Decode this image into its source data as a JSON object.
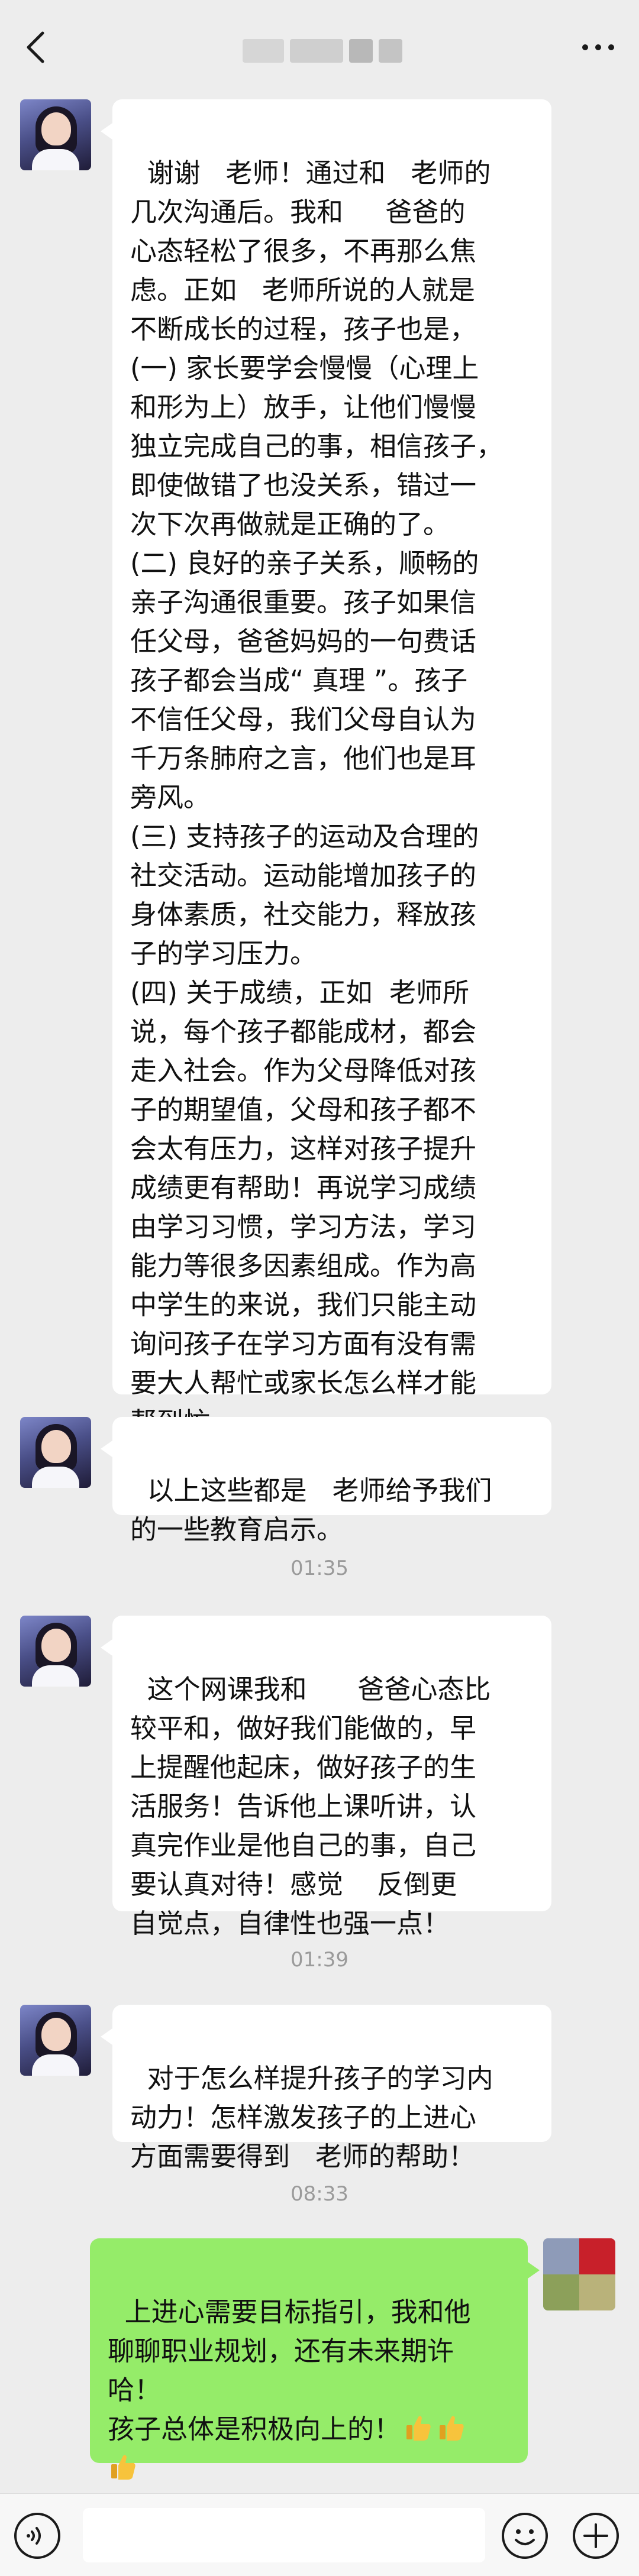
{
  "header": {
    "back_icon": "chevron-left-icon",
    "title": "",
    "more_icon": "more-dots-icon"
  },
  "messages": [
    {
      "side": "left",
      "text": "谢谢   老师！通过和   老师的\n几次沟通后。我和     爸爸的\n心态轻松了很多，不再那么焦\n虑。正如   老师所说的人就是\n不断成长的过程，孩子也是，\n(一) 家长要学会慢慢（心理上\n和形为上）放手，让他们慢慢\n独立完成自己的事，相信孩子，\n即使做错了也没关系，错过一\n次下次再做就是正确的了。\n(二) 良好的亲子关系，顺畅的\n亲子沟通很重要。孩子如果信\n任父母，爸爸妈妈的一句费话\n孩子都会当成“ 真理 ”。孩子\n不信任父母，我们父母自认为\n千万条肺府之言，他们也是耳\n旁风。\n(三) 支持孩子的运动及合理的\n社交活动。运动能增加孩子的\n身体素质，社交能力，释放孩\n子的学习压力。\n(四) 关于成绩，正如  老师所\n说，每个孩子都能成材，都会\n走入社会。作为父母降低对孩\n子的期望值，父母和孩子都不\n会太有压力，这样对孩子提升\n成绩更有帮助！再说学习成绩\n由学习习惯，学习方法，学习\n能力等很多因素组成。作为高\n中学生的来说，我们只能主动\n询问孩子在学习方面有没有需\n要大人帮忙或家长怎么样才能\n帮到忙。"
    },
    {
      "side": "left",
      "text": "以上这些都是   老师给予我们\n的一些教育启示。"
    },
    {
      "side": "left",
      "text": "这个网课我和      爸爸心态比\n较平和，做好我们能做的，早\n上提醒他起床，做好孩子的生\n活服务！告诉他上课听讲，认\n真完作业是他自己的事，自己\n要认真对待！感觉    反倒更\n自觉点，自律性也强一点！"
    },
    {
      "side": "left",
      "text": "对于怎么样提升孩子的学习内\n动力！怎样激发孩子的上进心\n方面需要得到   老师的帮助！"
    },
    {
      "side": "right",
      "text": "上进心需要目标指引，我和他\n聊聊职业规划，还有未来期许\n哈！\n孩子总体是积极向上的！"
    }
  ],
  "timestamps": [
    "01:35",
    "01:39",
    "08:33"
  ],
  "input_bar": {
    "voice_icon": "voice-icon",
    "emoji_icon": "emoji-icon",
    "plus_icon": "plus-icon",
    "input_value": ""
  },
  "emoji_name": "thumbs-up-icon"
}
